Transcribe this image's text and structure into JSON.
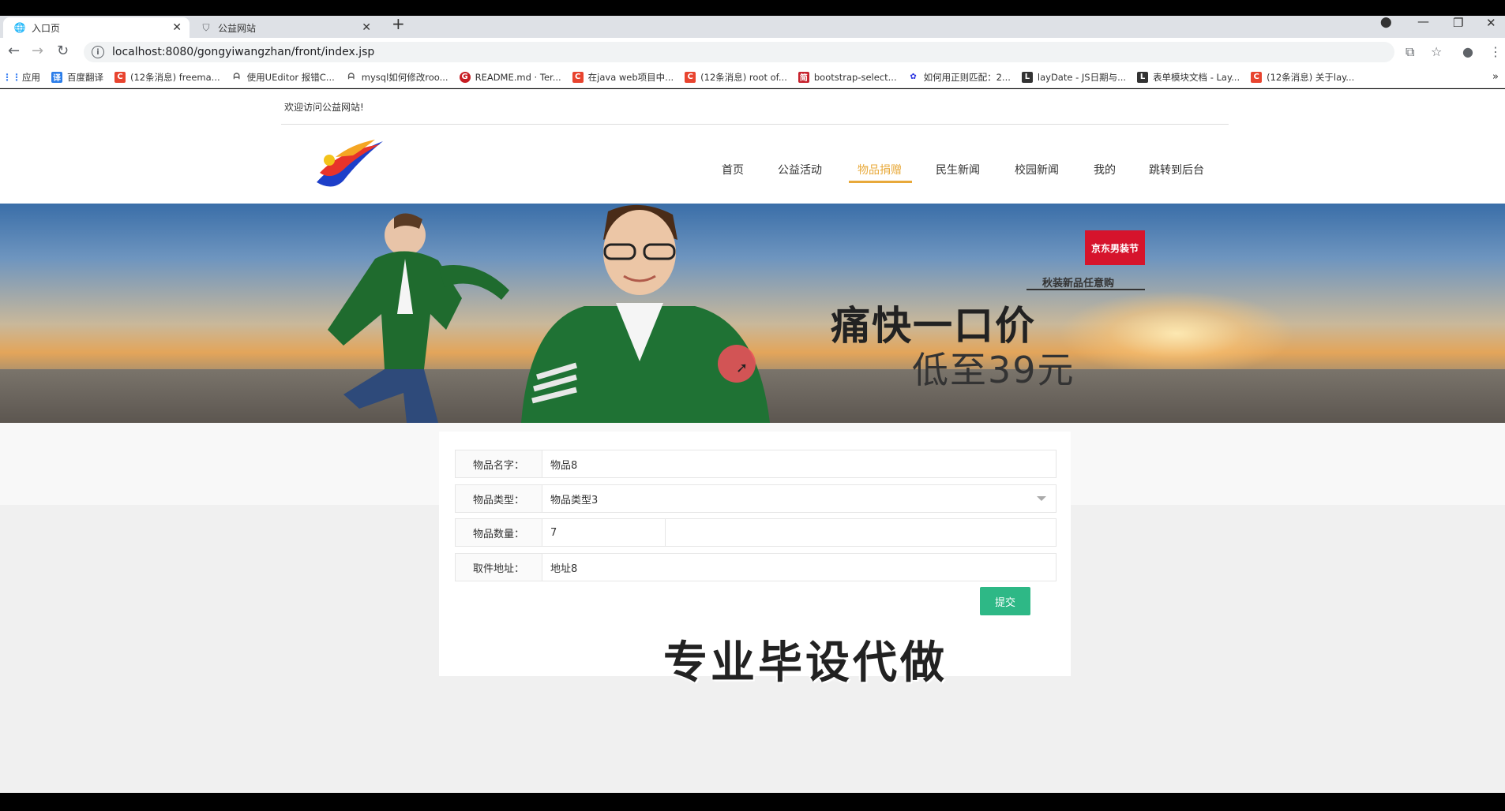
{
  "browser": {
    "tabs": [
      {
        "title": "入口页",
        "active": true
      },
      {
        "title": "公益网站",
        "active": false
      }
    ],
    "url": "localhost:8080/gongyiwangzhan/front/index.jsp",
    "bookmarks": [
      {
        "label": "应用",
        "color": "#4285f4"
      },
      {
        "label": "百度翻译",
        "color": "#2b7de9"
      },
      {
        "label": "(12条消息) freema...",
        "color": "#e8442f"
      },
      {
        "label": "使用UEditor 报错C...",
        "color": "#555"
      },
      {
        "label": "mysql如何修改roo...",
        "color": "#555"
      },
      {
        "label": "README.md · Ter...",
        "color": "#c71d23"
      },
      {
        "label": "在java web项目中...",
        "color": "#e8442f"
      },
      {
        "label": "(12条消息) root of...",
        "color": "#e8442f"
      },
      {
        "label": "bootstrap-select...",
        "color": "#c7232e"
      },
      {
        "label": "如何用正则匹配：2...",
        "color": "#2932e1"
      },
      {
        "label": "layDate - JS日期与...",
        "color": "#333"
      },
      {
        "label": "表单模块文档 - Lay...",
        "color": "#333"
      },
      {
        "label": "(12条消息) 关于lay...",
        "color": "#e8442f"
      }
    ]
  },
  "site": {
    "welcome": "欢迎访问公益网站!",
    "nav": [
      {
        "label": "首页",
        "active": false
      },
      {
        "label": "公益活动",
        "active": false
      },
      {
        "label": "物品捐赠",
        "active": true
      },
      {
        "label": "民生新闻",
        "active": false
      },
      {
        "label": "校园新闻",
        "active": false
      },
      {
        "label": "我的",
        "active": false
      },
      {
        "label": "跳转到后台",
        "active": false
      }
    ],
    "accent_color": "#e8a93a"
  },
  "banner": {
    "badge": "京东男装节",
    "subtitle": "秋装新品任意购",
    "headline": "痛快一口价",
    "price": "低至39元"
  },
  "form": {
    "fields": [
      {
        "label": "物品名字：",
        "value": "物品8"
      },
      {
        "label": "物品类型：",
        "value": "物品类型3"
      },
      {
        "label": "物品数量：",
        "value": "7"
      },
      {
        "label": "取件地址：",
        "value": "地址8"
      }
    ],
    "submit_label": "提交",
    "submit_color": "#2eb886"
  },
  "watermark": "专业毕设代做"
}
